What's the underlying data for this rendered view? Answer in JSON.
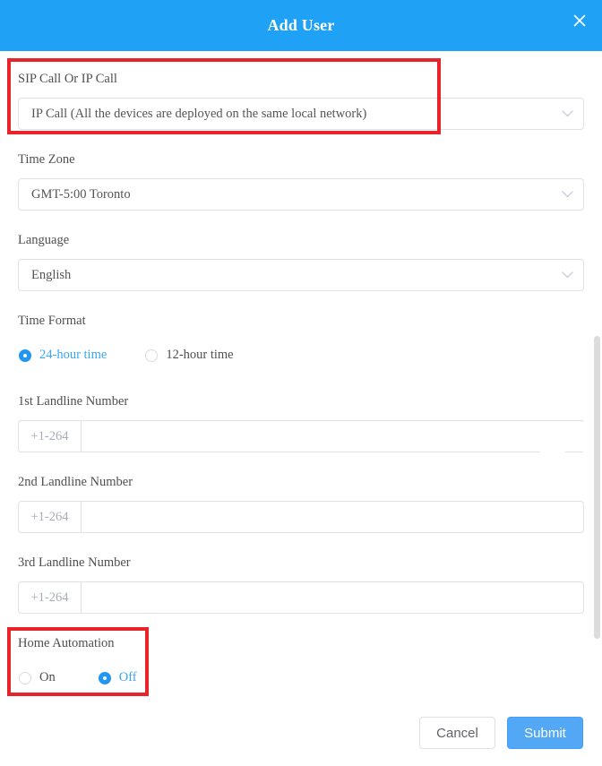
{
  "header": {
    "title": "Add User",
    "close_icon": "close-icon",
    "background_color": "#1fa2f5"
  },
  "form": {
    "call_mode": {
      "label": "SIP Call Or IP Call",
      "value": "IP Call  (All the devices are deployed on the same local network)",
      "chevron_icon": "chevron-down-icon"
    },
    "time_zone": {
      "label": "Time Zone",
      "value": "GMT-5:00 Toronto",
      "chevron_icon": "chevron-down-icon"
    },
    "language": {
      "label": "Language",
      "value": "English",
      "chevron_icon": "chevron-down-icon"
    },
    "time_format": {
      "label": "Time Format",
      "options": [
        {
          "label": "24-hour time",
          "selected": true
        },
        {
          "label": "12-hour time",
          "selected": false
        }
      ]
    },
    "landline_1": {
      "label": "1st Landline Number",
      "prefix": "+1-264",
      "value": "",
      "placeholder": ""
    },
    "landline_2": {
      "label": "2nd Landline Number",
      "prefix": "+1-264",
      "value": "",
      "placeholder": ""
    },
    "landline_3": {
      "label": "3rd Landline Number",
      "prefix": "+1-264",
      "value": "",
      "placeholder": ""
    },
    "home_automation": {
      "label": "Home Automation",
      "options": [
        {
          "label": "On",
          "selected": false
        },
        {
          "label": "Off",
          "selected": true
        }
      ]
    }
  },
  "footer": {
    "cancel_label": "Cancel",
    "submit_label": "Submit"
  },
  "annotations": {
    "highlight_color": "#e8232a",
    "boxes": [
      {
        "target": "SIP Call Or IP Call"
      },
      {
        "target": "Home Automation"
      }
    ]
  },
  "colors": {
    "accent": "#1fa2f5",
    "radio_selected": "#2196f3",
    "submit": "#53a8f5",
    "annotation": "#e8232a"
  }
}
